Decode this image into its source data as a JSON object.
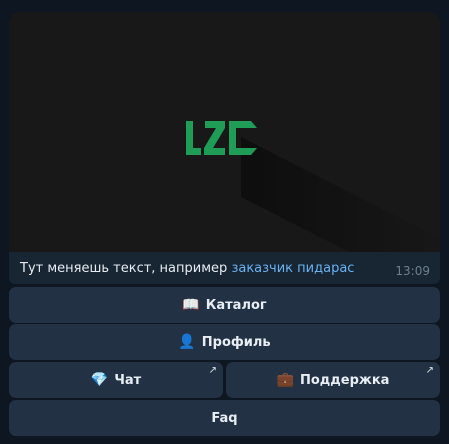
{
  "message": {
    "logo_text": "LZC",
    "caption_text": "Тут меняешь текст, например",
    "caption_link": "заказчик пидарас",
    "time": "13:09"
  },
  "keyboard": {
    "catalog": {
      "emoji": "📖",
      "label": "Каталог"
    },
    "profile": {
      "emoji": "👤",
      "label": "Профиль"
    },
    "chat": {
      "emoji": "💎",
      "label": "Чат",
      "arrow": "↗"
    },
    "support": {
      "emoji": "💼",
      "label": "Поддержка",
      "arrow": "↗"
    },
    "faq": {
      "label": "Faq"
    }
  },
  "colors": {
    "background": "#0e1621",
    "bubble": "#182533",
    "button": "#223244",
    "link": "#6ab2f2",
    "logo": "#1f9d57"
  }
}
